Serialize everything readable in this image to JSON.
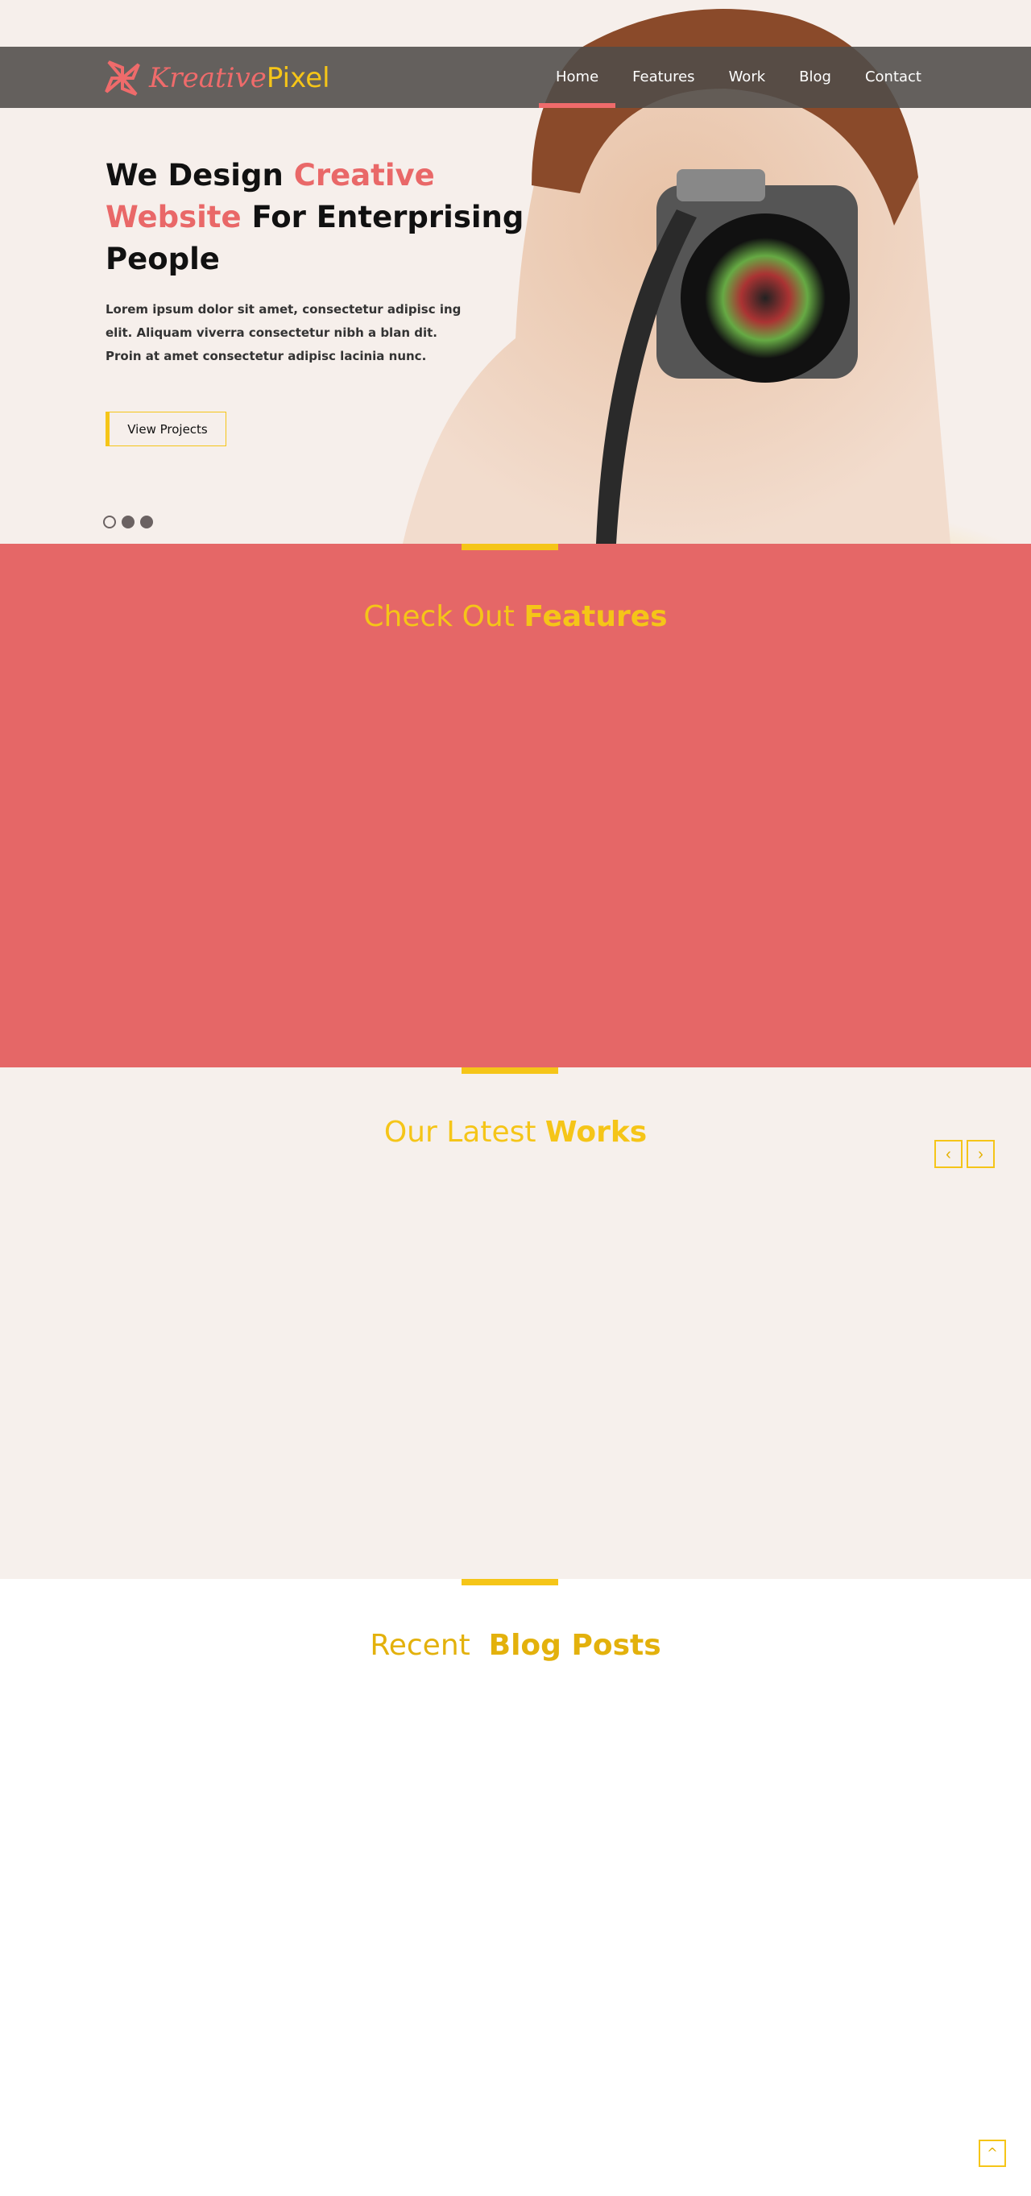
{
  "brand": {
    "name_part1": "Kreative",
    "name_part2": "Pixel"
  },
  "nav": {
    "items": [
      {
        "label": "Home",
        "active": true
      },
      {
        "label": "Features"
      },
      {
        "label": "Work"
      },
      {
        "label": "Blog"
      },
      {
        "label": "Contact"
      }
    ]
  },
  "hero": {
    "heading_pre": "We Design ",
    "heading_accent": "Creative Website",
    "heading_post": " For Enterprising People",
    "body": "Lorem ipsum dolor sit amet, consectetur adipisc ing elit. Aliquam viverra consectetur nibh a blan dit. Proin at amet consectetur adipisc lacinia nunc.",
    "button": "View Projects",
    "slides": 3,
    "active_slide": 1
  },
  "features": {
    "title_pre": "Check Out ",
    "title_bold": "Features"
  },
  "works": {
    "title_pre": "Our Latest ",
    "title_bold": "Works",
    "prev": "‹",
    "next": "›"
  },
  "blog": {
    "title_pre": "Recent  ",
    "title_bold": "Blog Posts"
  },
  "back_to_top": "^",
  "colors": {
    "coral": "#e56767",
    "yellow": "#f5c518",
    "cream": "#f6efeb",
    "nav": "#504c49"
  }
}
